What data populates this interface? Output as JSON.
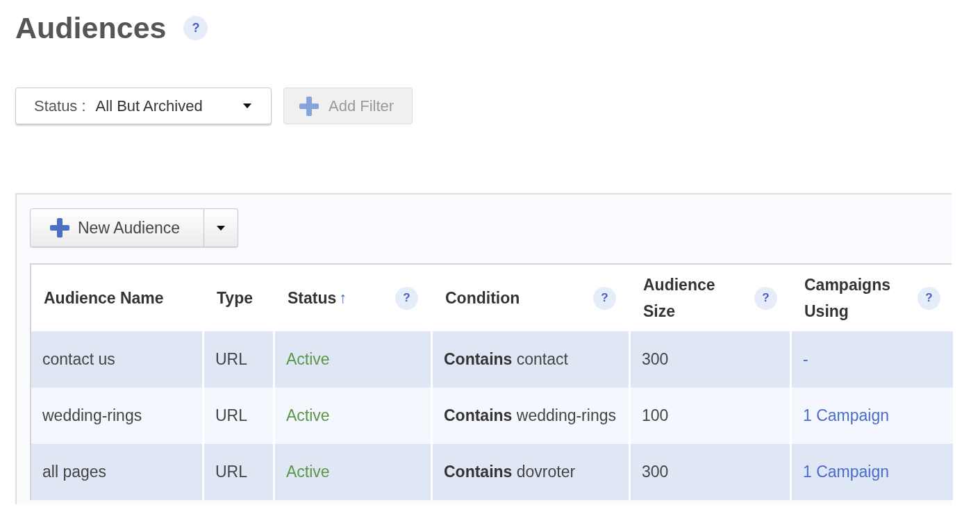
{
  "page": {
    "title": "Audiences",
    "help": "?"
  },
  "filters": {
    "status": {
      "label": "Status :",
      "value": "All But Archived"
    },
    "add_filter": {
      "label": "Add Filter",
      "disabled": true
    }
  },
  "toolbar": {
    "new_audience": {
      "label": "New Audience"
    }
  },
  "table": {
    "columns": [
      {
        "label": "Audience Name"
      },
      {
        "label": "Type"
      },
      {
        "label": "Status",
        "sort_arrow": "↑",
        "help": "?"
      },
      {
        "label": "Condition",
        "help": "?"
      },
      {
        "label": "Audience Size",
        "help": "?"
      },
      {
        "label": "Campaigns Using",
        "help": "?"
      }
    ],
    "rows": [
      {
        "cells": [
          {
            "kind": "text",
            "text": "contact us"
          },
          {
            "kind": "text",
            "text": "URL"
          },
          {
            "kind": "status",
            "text": "Active"
          },
          {
            "kind": "text",
            "text": "**Contains** contact"
          },
          {
            "kind": "text",
            "text": "300"
          },
          {
            "kind": "link",
            "text": "-"
          }
        ]
      },
      {
        "cells": [
          {
            "kind": "text",
            "text": "wedding-rings"
          },
          {
            "kind": "text",
            "text": "URL"
          },
          {
            "kind": "status",
            "text": "Active"
          },
          {
            "kind": "text",
            "text": "**Contains** wedding-rings"
          },
          {
            "kind": "text",
            "text": "100"
          },
          {
            "kind": "link",
            "text": "1 Campaign"
          }
        ]
      },
      {
        "cells": [
          {
            "kind": "text",
            "text": "all pages"
          },
          {
            "kind": "text",
            "text": "URL"
          },
          {
            "kind": "status",
            "text": "Active"
          },
          {
            "kind": "text",
            "text": "**Contains** dovroter"
          },
          {
            "kind": "text",
            "text": "300"
          },
          {
            "kind": "link",
            "text": "1 Campaign"
          }
        ]
      }
    ]
  }
}
